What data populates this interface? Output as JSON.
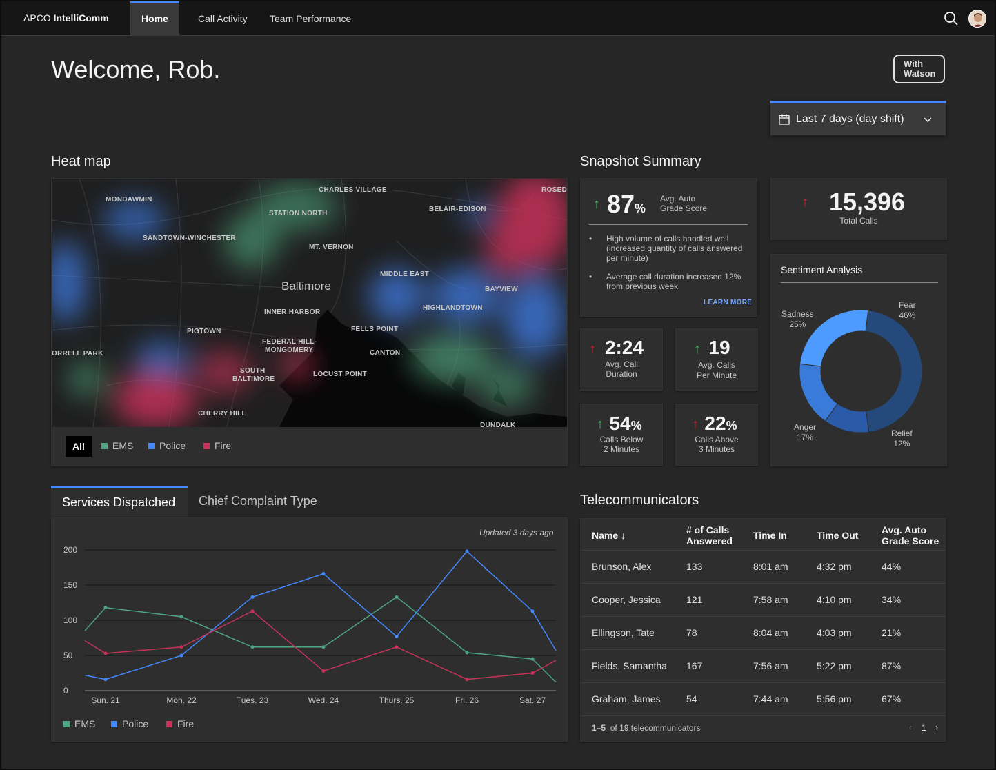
{
  "nav": {
    "brand_prefix": "APCO",
    "brand_name": "IntelliComm",
    "items": [
      {
        "label": "Home"
      },
      {
        "label": "Call Activity"
      },
      {
        "label": "Team Performance"
      }
    ],
    "search_icon": "search-icon",
    "avatar": "avatar"
  },
  "welcome": "Welcome, Rob.",
  "watson": {
    "line1": "With",
    "line2": "Watson"
  },
  "date_range": {
    "label": "Last 7 days (day shift)",
    "icon": "calendar-icon"
  },
  "heatmap": {
    "title": "Heat map",
    "city": "Baltimore",
    "neighborhoods": [
      "MONDAWMIN",
      "CHARLES VILLAGE",
      "ROSEDA",
      "STATION NORTH",
      "BELAIR-EDISON",
      "SANDTOWN-WINCHESTER",
      "MT. VERNON",
      "MIDDLE EAST",
      "BAYVIEW",
      "INNER HARBOR",
      "HIGHLANDTOWN",
      "PIGTOWN",
      "FELLS POINT",
      "FEDERAL HILL-",
      "MONGOMERY",
      "CANTON",
      "ORRELL PARK",
      "SOUTH",
      "BALTIMORE",
      "LOCUST POINT",
      "CHERRY HILL",
      "DUNDALK"
    ],
    "filters": {
      "all": "All",
      "ems": "EMS",
      "police": "Police",
      "fire": "Fire"
    }
  },
  "colors": {
    "ems": "#4fa582",
    "police": "#4589ff",
    "fire": "#c8325a",
    "accent": "#4589ff",
    "up_green": "#42be65",
    "up_red": "#da1e28"
  },
  "snapshot": {
    "title": "Snapshot Summary",
    "grade": {
      "value": "87",
      "unit": "%",
      "label1": "Avg. Auto",
      "label2": "Grade Score"
    },
    "bullets": [
      "High volume of calls handled well (increased quantity of calls answered per minute)",
      "Average call duration increased 12% from previous week"
    ],
    "learn_more": "LEARN MORE",
    "total_calls": {
      "value": "15,396",
      "label": "Total Calls"
    },
    "call_duration": {
      "value": "2:24",
      "label1": "Avg. Call",
      "label2": "Duration"
    },
    "calls_per_min": {
      "value": "19",
      "label1": "Avg. Calls",
      "label2": "Per Minute"
    },
    "below_2": {
      "value": "54",
      "unit": "%",
      "label1": "Calls Below",
      "label2": "2 Minutes"
    },
    "above_3": {
      "value": "22",
      "unit": "%",
      "label1": "Calls Above",
      "label2": "3 Minutes"
    }
  },
  "sentiment": {
    "title": "Sentiment Analysis",
    "slices": [
      {
        "name": "Fear",
        "value": 46,
        "label": "46%",
        "color": "#24497a"
      },
      {
        "name": "Relief",
        "value": 12,
        "label": "12%",
        "color": "#2a5aa8"
      },
      {
        "name": "Anger",
        "value": 17,
        "label": "17%",
        "color": "#3a7ad8"
      },
      {
        "name": "Sadness",
        "value": 25,
        "label": "25%",
        "color": "#4d9bff"
      }
    ]
  },
  "services": {
    "tab_active": "Services Dispatched",
    "tab_inactive": "Chief Complaint Type",
    "updated": "Updated 3 days ago",
    "legend": {
      "ems": "EMS",
      "police": "Police",
      "fire": "Fire"
    }
  },
  "chart_data": {
    "type": "line",
    "categories": [
      "Sun. 21",
      "Mon. 22",
      "Tues. 23",
      "Wed. 24",
      "Thurs. 25",
      "Fri. 26",
      "Sat. 27"
    ],
    "ylim": [
      0,
      200
    ],
    "yticks": [
      0,
      50,
      100,
      150,
      200
    ],
    "grid": true,
    "legend_position": "bottom-left",
    "series": [
      {
        "name": "EMS",
        "start": 85,
        "values": [
          118,
          105,
          62,
          62,
          133,
          54,
          45
        ],
        "end": 12
      },
      {
        "name": "Police",
        "start": 22,
        "values": [
          16,
          50,
          133,
          166,
          77,
          198,
          113
        ],
        "end": 57
      },
      {
        "name": "Fire",
        "start": 71,
        "values": [
          53,
          62,
          113,
          28,
          62,
          16,
          25
        ],
        "end": 43
      }
    ]
  },
  "telecom": {
    "title": "Telecommunicators",
    "headers": {
      "name": "Name",
      "calls1": "# of Calls",
      "calls2": "Answered",
      "time_in": "Time In",
      "time_out": "Time Out",
      "grade1": "Avg. Auto",
      "grade2": "Grade Score"
    },
    "rows": [
      {
        "name": "Brunson, Alex",
        "calls": "133",
        "in": "8:01 am",
        "out": "4:32 pm",
        "grade": "44%"
      },
      {
        "name": "Cooper, Jessica",
        "calls": "121",
        "in": "7:58 am",
        "out": "4:10 pm",
        "grade": "34%"
      },
      {
        "name": "Ellingson, Tate",
        "calls": "78",
        "in": "8:04 am",
        "out": "4:03 pm",
        "grade": "21%"
      },
      {
        "name": "Fields, Samantha",
        "calls": "167",
        "in": "7:56 am",
        "out": "5:22 pm",
        "grade": "87%"
      },
      {
        "name": "Graham, James",
        "calls": "54",
        "in": "7:44 am",
        "out": "5:56 pm",
        "grade": "67%"
      }
    ],
    "footer": {
      "range": "1–5",
      "of": "of",
      "total": "19 telecommunicators",
      "page": "1"
    }
  }
}
